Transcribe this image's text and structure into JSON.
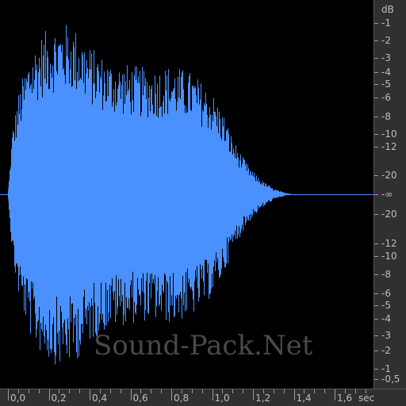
{
  "waveform": {
    "color": "#4a90ff",
    "background": "#000000",
    "duration_label_unit": "sec",
    "peak_envelope_sec_to_level": [
      [
        0.0,
        0.02
      ],
      [
        0.02,
        0.35
      ],
      [
        0.05,
        0.55
      ],
      [
        0.1,
        0.75
      ],
      [
        0.15,
        0.85
      ],
      [
        0.2,
        0.9
      ],
      [
        0.25,
        0.93
      ],
      [
        0.3,
        0.92
      ],
      [
        0.35,
        0.88
      ],
      [
        0.4,
        0.8
      ],
      [
        0.5,
        0.72
      ],
      [
        0.6,
        0.7
      ],
      [
        0.7,
        0.68
      ],
      [
        0.8,
        0.7
      ],
      [
        0.9,
        0.66
      ],
      [
        1.0,
        0.55
      ],
      [
        1.05,
        0.45
      ],
      [
        1.1,
        0.3
      ],
      [
        1.15,
        0.2
      ],
      [
        1.2,
        0.12
      ],
      [
        1.25,
        0.07
      ],
      [
        1.3,
        0.03
      ],
      [
        1.35,
        0.01
      ],
      [
        1.4,
        0.0
      ],
      [
        1.8,
        0.0
      ]
    ]
  },
  "db_scale": {
    "unit": "dB",
    "labels": [
      "-1",
      "-2",
      "-3",
      "-4",
      "-5",
      "-6",
      "-8",
      "-10",
      "-12",
      "-20",
      "-∞",
      "-20",
      "-12",
      "-10",
      "-8",
      "-6",
      "-5",
      "-4",
      "-3",
      "-2",
      "-1",
      "-0,5"
    ]
  },
  "time_scale": {
    "labels": [
      "0,0",
      "0,2",
      "0,4",
      "0,6",
      "0,8",
      "1,0",
      "1,2",
      "1,4",
      "1,6"
    ],
    "unit": "sec"
  },
  "watermark": "Sound-Pack.Net"
}
